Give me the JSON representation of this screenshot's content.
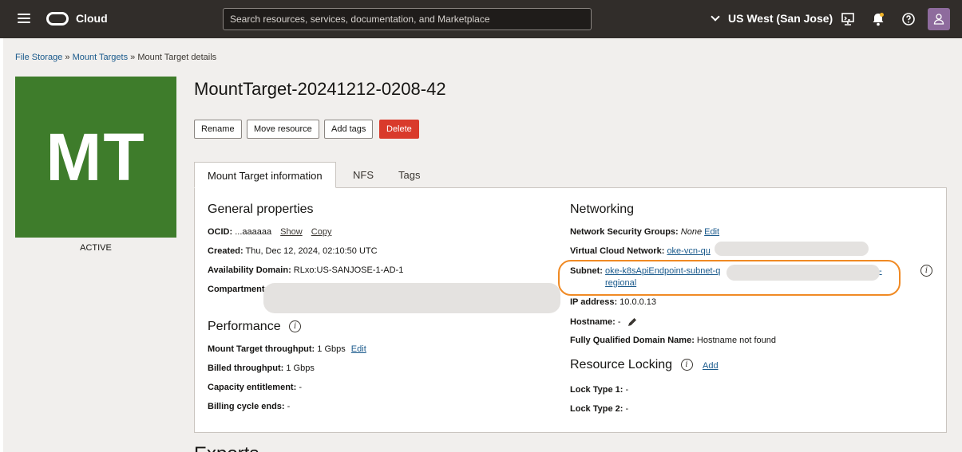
{
  "topbar": {
    "brand": "Cloud",
    "search_placeholder": "Search resources, services, documentation, and Marketplace",
    "region": "US West (San Jose)"
  },
  "breadcrumb": {
    "items": [
      "File Storage",
      "Mount Targets",
      "Mount Target details"
    ],
    "separator": "»"
  },
  "resource": {
    "tile_initials": "MT",
    "tile_color": "#3e7c2b",
    "state": "ACTIVE",
    "title": "MountTarget-20241212-0208-42"
  },
  "actions": {
    "rename": "Rename",
    "move": "Move resource",
    "add_tags": "Add tags",
    "delete": "Delete",
    "delete_color": "#d93a2b"
  },
  "tabs": [
    "Mount Target information",
    "NFS",
    "Tags"
  ],
  "general": {
    "heading": "General properties",
    "ocid_label": "OCID:",
    "ocid_value": "...aaaaaa",
    "show": "Show",
    "copy": "Copy",
    "created_label": "Created:",
    "created_value": "Thu, Dec 12, 2024, 02:10:50 UTC",
    "ad_label": "Availability Domain:",
    "ad_value": "RLxo:US-SANJOSE-1-AD-1",
    "compartment_label": "Compartment:"
  },
  "performance": {
    "heading": "Performance",
    "throughput_label": "Mount Target throughput:",
    "throughput_value": "1 Gbps",
    "edit": "Edit",
    "billed_label": "Billed throughput:",
    "billed_value": "1 Gbps",
    "capacity_label": "Capacity entitlement:",
    "capacity_value": "-",
    "billing_label": "Billing cycle ends:",
    "billing_value": "-"
  },
  "networking": {
    "heading": "Networking",
    "nsg_label": "Network Security Groups:",
    "nsg_value": "None",
    "edit": "Edit",
    "vcn_label": "Virtual Cloud Network:",
    "vcn_value": "oke-vcn-qu",
    "subnet_label": "Subnet:",
    "subnet_value": "oke-k8sApiEndpoint-subnet-q",
    "subnet_tail": "-",
    "subnet_line2": "regional",
    "ip_label": "IP address:",
    "ip_value": "10.0.0.13",
    "hostname_label": "Hostname:",
    "hostname_value": "-",
    "fqdn_label": "Fully Qualified Domain Name:",
    "fqdn_value": "Hostname not found",
    "highlight_color": "#f08a24"
  },
  "locking": {
    "heading": "Resource Locking",
    "add": "Add",
    "lock1_label": "Lock Type 1:",
    "lock1_value": "-",
    "lock2_label": "Lock Type 2:",
    "lock2_value": "-"
  },
  "exports": {
    "heading": "Exports"
  }
}
